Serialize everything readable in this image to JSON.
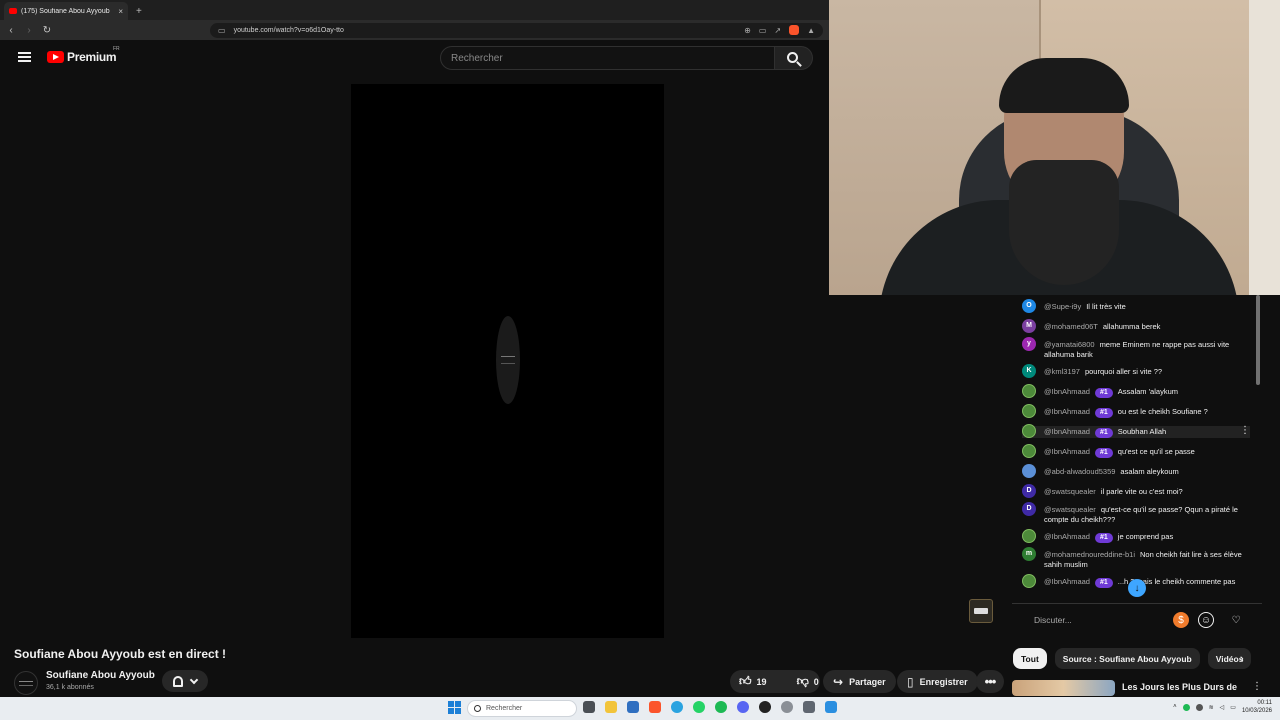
{
  "browser": {
    "tab_title": "(175) Soufiane Abou Ayyoub",
    "tab_close": "×",
    "new_tab": "+",
    "url": "youtube.com/watch?v=o6d1Oay-tto"
  },
  "header": {
    "logo_text": "Premium",
    "country_code": "FR",
    "search_placeholder": "Rechercher"
  },
  "video": {
    "title": "Soufiane Abou Ayyoub est en direct !",
    "channel_name": "Soufiane Abou Ayyoub",
    "subscribers": "36,1 k abonnés",
    "likes": "19",
    "dislikes": "0",
    "share_label": "Partager",
    "save_label": "Enregistrer"
  },
  "chat": {
    "messages": [
      {
        "avatar": "O",
        "avatar_color": "#1e88e5",
        "author": "@Supe-i9y",
        "badge": "",
        "text": "Il lit très vite"
      },
      {
        "avatar": "M",
        "avatar_color": "#7b3fa0",
        "author": "@mohamed06T",
        "badge": "",
        "text": "allahumma berek"
      },
      {
        "avatar": "y",
        "avatar_color": "#9c27b0",
        "author": "@yamatai6800",
        "badge": "",
        "text": "meme Eminem ne rappe pas aussi vite allahuma barik"
      },
      {
        "avatar": "K",
        "avatar_color": "#00897b",
        "author": "@kml3197",
        "badge": "",
        "text": "pourquoi aller si vite ??"
      },
      {
        "avatar": "",
        "avatar_color": "#4d8a3a",
        "author": "@IbnAhmaad",
        "badge": "#1",
        "text": "Assalam 'alaykum"
      },
      {
        "avatar": "",
        "avatar_color": "#4d8a3a",
        "author": "@IbnAhmaad",
        "badge": "#1",
        "text": "ou est le cheikh Soufiane ?"
      },
      {
        "avatar": "",
        "avatar_color": "#4d8a3a",
        "author": "@IbnAhmaad",
        "badge": "#1",
        "text": "Soubhan Allah"
      },
      {
        "avatar": "",
        "avatar_color": "#4d8a3a",
        "author": "@IbnAhmaad",
        "badge": "#1",
        "text": "qu'est ce qu'il se passe"
      },
      {
        "avatar": "",
        "avatar_color": "#5b8fd6",
        "author": "@abd-alwadoud5359",
        "badge": "",
        "text": "asalam aleykoum"
      },
      {
        "avatar": "D",
        "avatar_color": "#3f2aa6",
        "author": "@swatsquealer",
        "badge": "",
        "text": "il parle vite ou c'est moi?"
      },
      {
        "avatar": "D",
        "avatar_color": "#3f2aa6",
        "author": "@swatsquealer",
        "badge": "",
        "text": "qu'est-ce qu'il se passe? Qqun a piraté le compte du cheikh???"
      },
      {
        "avatar": "",
        "avatar_color": "#4d8a3a",
        "author": "@IbnAhmaad",
        "badge": "#1",
        "text": "je comprend pas"
      },
      {
        "avatar": "m",
        "avatar_color": "#2e7d32",
        "author": "@mohamednoureddine-b1i",
        "badge": "",
        "text": "Non cheikh fait lire à ses élève sahih muslim"
      },
      {
        "avatar": "",
        "avatar_color": "#4d8a3a",
        "author": "@IbnAhmaad",
        "badge": "#1",
        "text": "...h ? mais le cheikh commente pas"
      }
    ],
    "input_placeholder": "Discuter...",
    "more_menu": "⋮",
    "jump_down": "↓"
  },
  "related": {
    "chips": [
      "Tout",
      "Source : Soufiane Abou Ayyoub",
      "Vidéos"
    ],
    "first_title": "Les Jours les Plus Durs de"
  },
  "taskbar": {
    "search_placeholder": "Rechercher",
    "time": "00:11",
    "date": "10/03/2026"
  },
  "icons": {
    "like": "thumbs-up-icon",
    "dislike": "thumbs-down-icon",
    "share": "share-icon",
    "save": "bookmark-icon",
    "bell": "bell-icon"
  }
}
